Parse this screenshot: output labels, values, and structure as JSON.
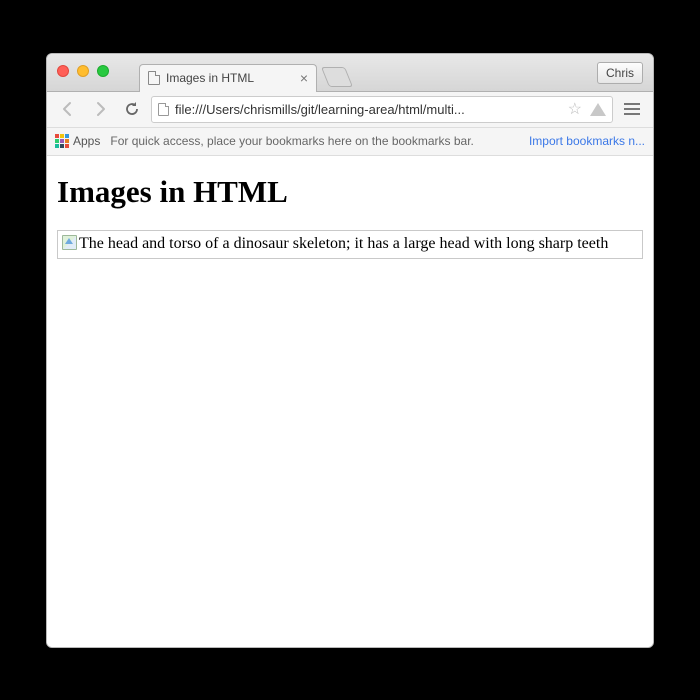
{
  "window": {
    "tab_title": "Images in HTML",
    "user_button": "Chris"
  },
  "toolbar": {
    "url": "file:///Users/chrismills/git/learning-area/html/multi..."
  },
  "bookmarks_bar": {
    "apps_label": "Apps",
    "hint": "For quick access, place your bookmarks here on the bookmarks bar.",
    "import_link": "Import bookmarks n..."
  },
  "page": {
    "heading": "Images in HTML",
    "alt_text": "The head and torso of a dinosaur skeleton; it has a large head with long sharp teeth"
  }
}
